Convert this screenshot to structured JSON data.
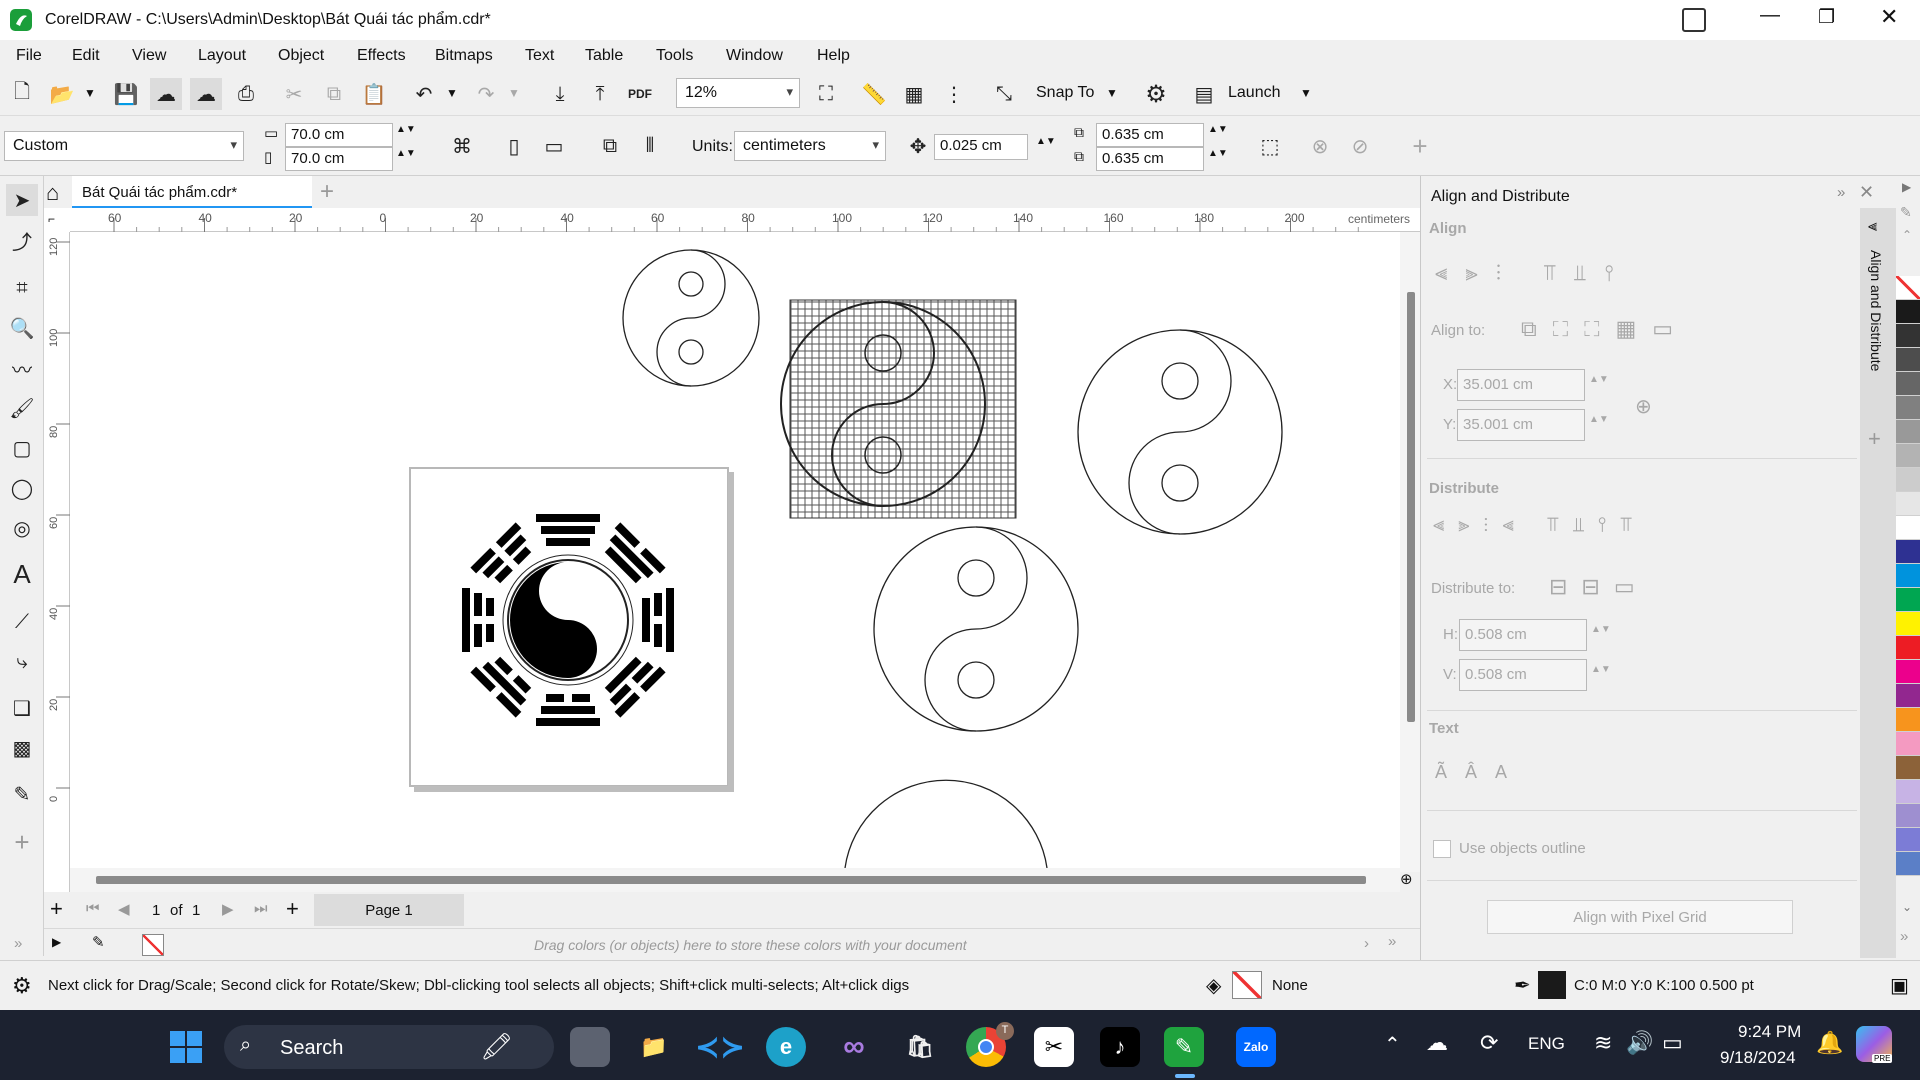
{
  "app": {
    "title": "CorelDRAW - C:\\Users\\Admin\\Desktop\\Bát Quái tác phẩm.cdr*"
  },
  "menu": [
    "File",
    "Edit",
    "View",
    "Layout",
    "Object",
    "Effects",
    "Bitmaps",
    "Text",
    "Table",
    "Tools",
    "Window",
    "Help"
  ],
  "toolbar": {
    "pdf_label": "PDF",
    "zoom": "12%",
    "snap_to": "Snap To",
    "launch": "Launch"
  },
  "properties": {
    "page_preset": "Custom",
    "width": "70.0 cm",
    "height": "70.0 cm",
    "units_label": "Units:",
    "units": "centimeters",
    "nudge": "0.025 cm",
    "dup_x": "0.635 cm",
    "dup_y": "0.635 cm"
  },
  "document": {
    "tab": "Bát Quái tác phẩm.cdr*",
    "ruler_unit": "centimeters",
    "ruler_h_ticks": [
      "60",
      "40",
      "20",
      "0",
      "20",
      "40",
      "60",
      "80",
      "100",
      "120",
      "140",
      "160",
      "180",
      "200"
    ],
    "ruler_v_ticks": [
      "120",
      "100",
      "80",
      "60",
      "40",
      "20",
      "0"
    ]
  },
  "pages": {
    "current": "1",
    "of": "of",
    "total": "1",
    "page_tab": "Page 1"
  },
  "colorstrip": {
    "hint": "Drag colors (or objects) here to store these colors with your document"
  },
  "docker": {
    "title": "Align and Distribute",
    "tab_label": "Align and Distribute",
    "align_section": "Align",
    "align_to": "Align to:",
    "x_label": "X:",
    "x_value": "35.001 cm",
    "y_label": "Y:",
    "y_value": "35.001 cm",
    "distribute_section": "Distribute",
    "distribute_to": "Distribute to:",
    "h_label": "H:",
    "h_value": "0.508 cm",
    "v_label": "V:",
    "v_value": "0.508 cm",
    "text_section": "Text",
    "use_outline": "Use objects outline",
    "pixel_grid_button": "Align with Pixel Grid"
  },
  "palette": {
    "colors": [
      "#ffffff",
      "#1a1a1a",
      "#333333",
      "#4d4d4d",
      "#666666",
      "#808080",
      "#999999",
      "#b3b3b3",
      "#cccccc",
      "#e6e6e6",
      "#ffffff",
      "#2e3192",
      "#0093dd",
      "#00a651",
      "#fff200",
      "#ed1c24",
      "#ec008c",
      "#92278f",
      "#f7941d",
      "#f49ac1",
      "#8c6239",
      "#c7b3e5",
      "#9e8fd0",
      "#7c7cd6",
      "#5b7fc7"
    ]
  },
  "status": {
    "hint": "Next click for Drag/Scale; Second click for Rotate/Skew; Dbl-clicking tool selects all objects; Shift+click multi-selects; Alt+click digs",
    "fill": "None",
    "outline": "C:0 M:0 Y:0 K:100  0.500 pt"
  },
  "taskbar": {
    "search": "Search",
    "lang": "ENG",
    "time": "9:24 PM",
    "date": "9/18/2024",
    "tiktok_badge": "T",
    "zalo": "Zalo",
    "copilot_badge": "PRE"
  }
}
